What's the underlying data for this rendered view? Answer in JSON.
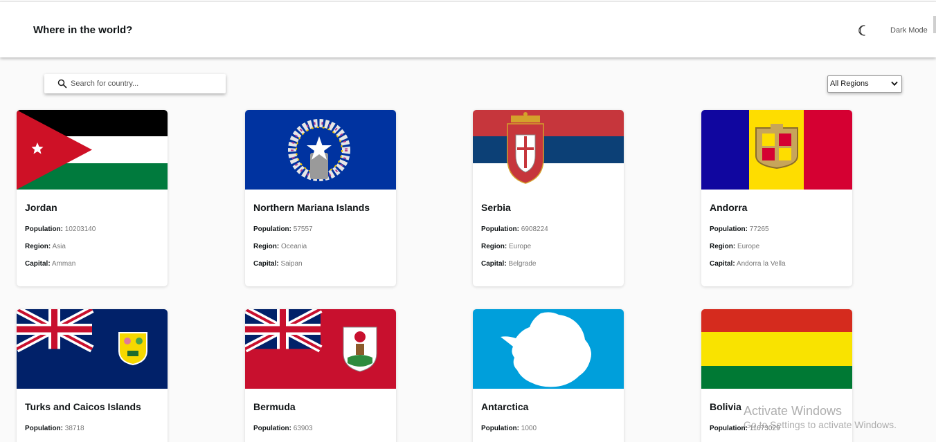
{
  "header": {
    "title": "Where in the world?",
    "theme_toggle_label": "Dark Mode",
    "theme_icon": "moon-icon"
  },
  "search": {
    "placeholder": "Search for country...",
    "value": "",
    "icon": "search-icon"
  },
  "filter": {
    "selected": "All Regions",
    "icon": "chevron-down-icon"
  },
  "labels": {
    "population": "Population:",
    "region": "Region:",
    "capital": "Capital:"
  },
  "countries": [
    {
      "name": "Jordan",
      "population": "10203140",
      "region": "Asia",
      "capital": "Amman"
    },
    {
      "name": "Northern Mariana Islands",
      "population": "57557",
      "region": "Oceania",
      "capital": "Saipan"
    },
    {
      "name": "Serbia",
      "population": "6908224",
      "region": "Europe",
      "capital": "Belgrade"
    },
    {
      "name": "Andorra",
      "population": "77265",
      "region": "Europe",
      "capital": "Andorra la Vella"
    },
    {
      "name": "Turks and Caicos Islands",
      "population": "38718"
    },
    {
      "name": "Bermuda",
      "population": "63903"
    },
    {
      "name": "Antarctica",
      "population": "1000"
    },
    {
      "name": "Bolivia",
      "population": "11673029"
    }
  ],
  "watermark": {
    "line1": "Activate Windows",
    "line2": "Go to Settings to activate Windows."
  },
  "colors": {
    "background": "#fafafa",
    "card": "#ffffff",
    "text": "#111517"
  }
}
